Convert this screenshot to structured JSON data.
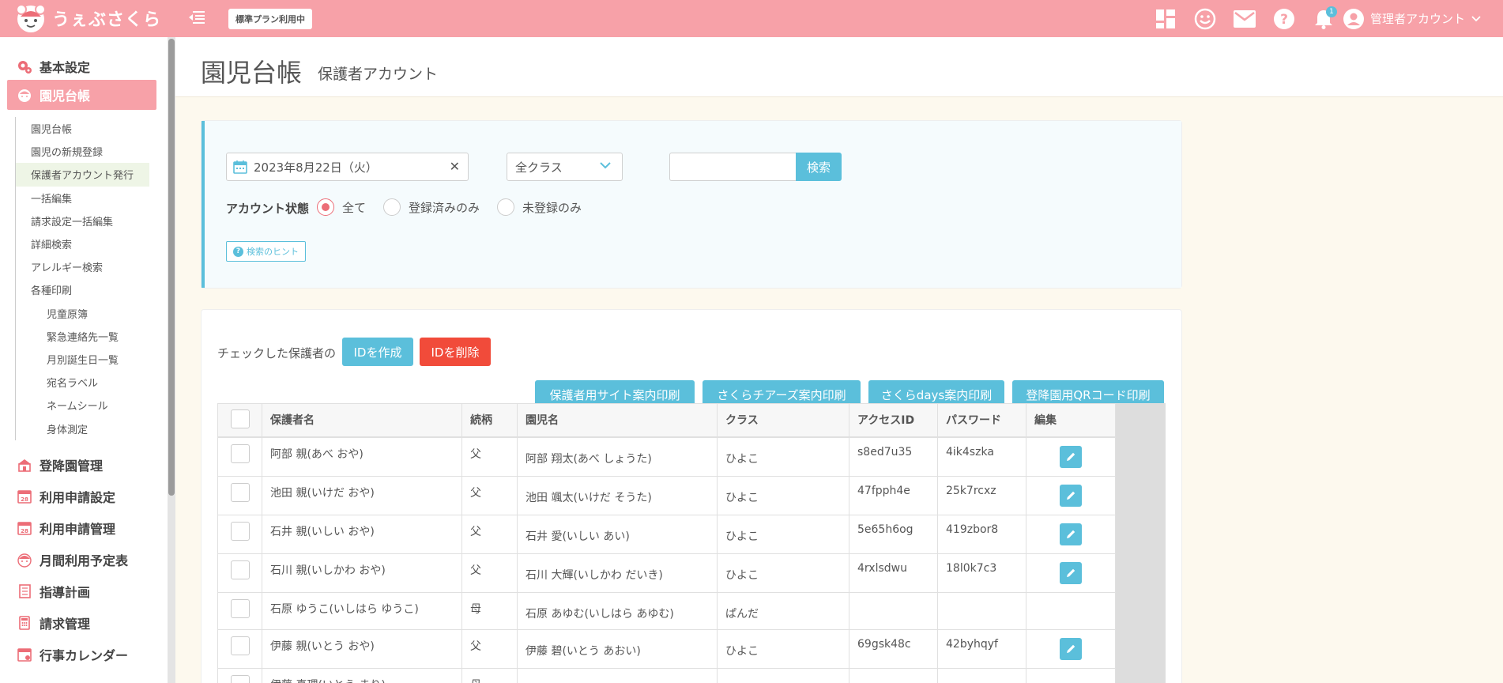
{
  "header": {
    "logo_text": "うぇぶさくら",
    "plan_badge": "標準プラン利用中",
    "notification_count": "1",
    "account_label": "管理者アカウント"
  },
  "sidebar": {
    "top_items": [
      {
        "label": "基本設定",
        "icon": "gear-icon"
      },
      {
        "label": "園児台帳",
        "icon": "child-face-icon",
        "active": true
      }
    ],
    "sub_items": [
      {
        "label": "園児台帳"
      },
      {
        "label": "園児の新規登録"
      },
      {
        "label": "保護者アカウント発行",
        "active": true
      },
      {
        "label": "一括編集"
      },
      {
        "label": "請求設定一括編集"
      },
      {
        "label": "詳細検索"
      },
      {
        "label": "アレルギー検索"
      },
      {
        "label": "各種印刷"
      },
      {
        "label": "児童原簿",
        "indent": true
      },
      {
        "label": "緊急連絡先一覧",
        "indent": true
      },
      {
        "label": "月別誕生日一覧",
        "indent": true
      },
      {
        "label": "宛名ラベル",
        "indent": true
      },
      {
        "label": "ネームシール",
        "indent": true
      },
      {
        "label": "身体測定",
        "indent": true
      }
    ],
    "bottom_items": [
      {
        "label": "登降園管理",
        "icon": "school-icon"
      },
      {
        "label": "利用申請設定",
        "icon": "calendar-icon"
      },
      {
        "label": "利用申請管理",
        "icon": "calendar-icon"
      },
      {
        "label": "月間利用予定表",
        "icon": "child-face-icon"
      },
      {
        "label": "指導計画",
        "icon": "notebook-icon"
      },
      {
        "label": "請求管理",
        "icon": "calculator-icon"
      },
      {
        "label": "行事カレンダー",
        "icon": "event-calendar-icon"
      }
    ]
  },
  "page": {
    "title": "園児台帳",
    "subtitle": "保護者アカウント"
  },
  "search": {
    "date_value": "2023年8月22日（火）",
    "class_value": "全クラス",
    "keyword_value": "",
    "search_button": "検索",
    "status_label": "アカウント状態",
    "status_options": [
      {
        "label": "全て",
        "checked": true
      },
      {
        "label": "登録済みのみ",
        "checked": false
      },
      {
        "label": "未登録のみ",
        "checked": false
      }
    ],
    "hint_button": "検索のヒント"
  },
  "actions": {
    "checked_label": "チェックした保護者の",
    "create_id": "IDを作成",
    "delete_id": "IDを削除",
    "print_buttons": [
      "保護者用サイト案内印刷",
      "さくらチアーズ案内印刷",
      "さくらdays案内印刷",
      "登降園用QRコード印刷"
    ]
  },
  "table": {
    "headers": [
      "保護者名",
      "続柄",
      "園児名",
      "クラス",
      "アクセスID",
      "パスワード",
      "編集"
    ],
    "rows": [
      {
        "guardian": "阿部 親(あべ おや)",
        "relation": "父",
        "child": "阿部 翔太(あべ しょうた)",
        "class": "ひよこ",
        "access_id": "s8ed7u35",
        "password": "4ik4szka",
        "editable": true
      },
      {
        "guardian": "池田 親(いけだ おや)",
        "relation": "父",
        "child": "池田 颯太(いけだ そうた)",
        "class": "ひよこ",
        "access_id": "47fpph4e",
        "password": "25k7rcxz",
        "editable": true
      },
      {
        "guardian": "石井 親(いしい おや)",
        "relation": "父",
        "child": "石井 愛(いしい あい)",
        "class": "ひよこ",
        "access_id": "5e65h6og",
        "password": "419zbor8",
        "editable": true
      },
      {
        "guardian": "石川 親(いしかわ おや)",
        "relation": "父",
        "child": "石川 大輝(いしかわ だいき)",
        "class": "ひよこ",
        "access_id": "4rxlsdwu",
        "password": "18l0k7c3",
        "editable": true
      },
      {
        "guardian": "石原 ゆうこ(いしはら ゆうこ)",
        "relation": "母",
        "child": "石原 あゆむ(いしはら あゆむ)",
        "class": "ぱんだ",
        "access_id": "",
        "password": "",
        "editable": false
      },
      {
        "guardian": "伊藤 親(いとう おや)",
        "relation": "父",
        "child": "伊藤 碧(いとう あおい)",
        "class": "ひよこ",
        "access_id": "69gsk48c",
        "password": "42byhqyf",
        "editable": true
      },
      {
        "guardian": "伊藤 真理(いとう まり)",
        "relation": "母",
        "child": "伊藤 はな(いとう はな)",
        "class": "ばら",
        "access_id": "",
        "password": "",
        "editable": false
      }
    ]
  },
  "colors": {
    "header_pink": "#f7a1a8",
    "accent_blue": "#5bbfdb",
    "danger_red": "#f14b3a",
    "radio_pink": "#ec6d77",
    "content_bg": "#fdf9ee"
  }
}
